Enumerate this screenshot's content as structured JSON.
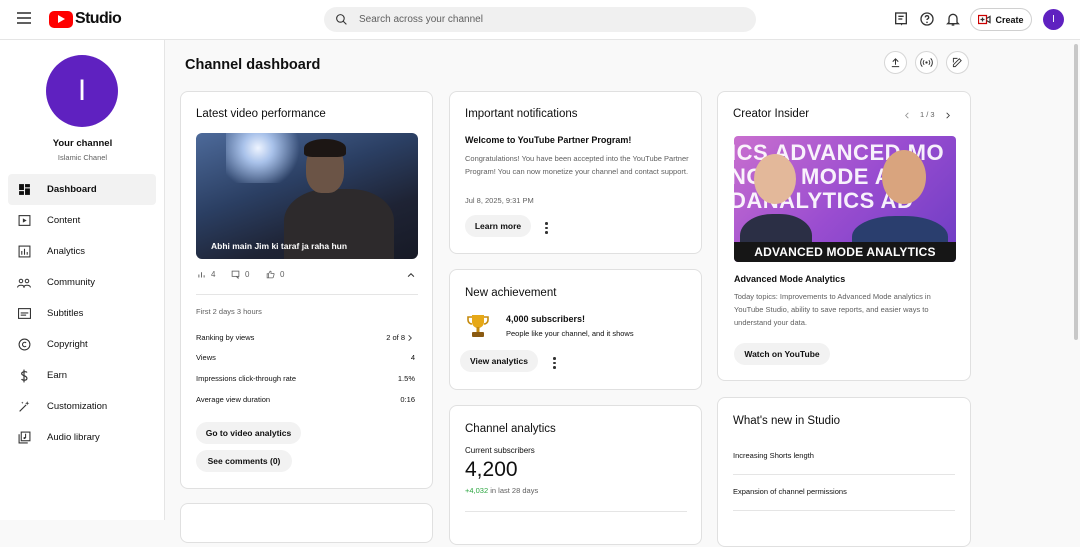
{
  "topbar": {
    "logo_text": "Studio",
    "search_placeholder": "Search across your channel",
    "create_label": "Create",
    "avatar_letter": "I"
  },
  "sidebar": {
    "avatar_letter": "I",
    "channel_title": "Your channel",
    "channel_name": "Islamic Chanel",
    "items": [
      {
        "label": "Dashboard",
        "icon": "dashboard-icon",
        "active": true
      },
      {
        "label": "Content",
        "icon": "content-icon"
      },
      {
        "label": "Analytics",
        "icon": "analytics-icon"
      },
      {
        "label": "Community",
        "icon": "community-icon"
      },
      {
        "label": "Subtitles",
        "icon": "subtitles-icon"
      },
      {
        "label": "Copyright",
        "icon": "copyright-icon"
      },
      {
        "label": "Earn",
        "icon": "earn-icon"
      },
      {
        "label": "Customization",
        "icon": "customization-icon"
      },
      {
        "label": "Audio library",
        "icon": "audio-library-icon"
      }
    ]
  },
  "main": {
    "page_title": "Channel dashboard",
    "latest_video": {
      "title": "Latest video performance",
      "video_title": "Abhi main Jim ki taraf ja raha hun",
      "views_count": "4",
      "comments_count": "0",
      "likes_count": "0",
      "period": "First 2 days 3 hours",
      "rows": [
        {
          "label": "Ranking by views",
          "value": "2 of 8"
        },
        {
          "label": "Views",
          "value": "4"
        },
        {
          "label": "Impressions click-through rate",
          "value": "1.5%"
        },
        {
          "label": "Average view duration",
          "value": "0:16"
        }
      ],
      "analytics_button": "Go to video analytics",
      "comments_button": "See comments (0)"
    },
    "notifications": {
      "title": "Important notifications",
      "headline": "Welcome to YouTube Partner Program!",
      "body": "Congratulations! You have been accepted into the YouTube Partner Program! You can now monetize your channel and contact support.",
      "date": "Jul 8, 2025, 9:31 PM",
      "button": "Learn more"
    },
    "achievement": {
      "title": "New achievement",
      "headline": "4,000 subscribers!",
      "body": "People like your channel, and it shows",
      "button": "View analytics"
    },
    "channel_analytics": {
      "title": "Channel analytics",
      "subs_label": "Current subscribers",
      "subs_value": "4,200",
      "change": "+4,032",
      "change_suffix": "in last 28 days",
      "accent_green": "#2ba640"
    },
    "creator_insider": {
      "title": "Creator Insider",
      "pager": "1 / 3",
      "thumb_banner": "ADVANCED MODE ANALYTICS",
      "thumb_bg_lines": [
        "ICS ADVANCED MO",
        "NCED MODE AN",
        "DANALYTICS AD"
      ],
      "video_title": "Advanced Mode Analytics",
      "description": "Today topics: Improvements to Advanced Mode analytics in YouTube Studio, ability to save reports, and easier ways to understand your data.",
      "button": "Watch on YouTube"
    },
    "whats_new": {
      "title": "What's new in Studio",
      "items": [
        "Increasing Shorts length",
        "Expansion of channel permissions"
      ]
    }
  },
  "colors": {
    "brand_red": "#ff0000",
    "avatar_purple": "#5f21c0"
  }
}
